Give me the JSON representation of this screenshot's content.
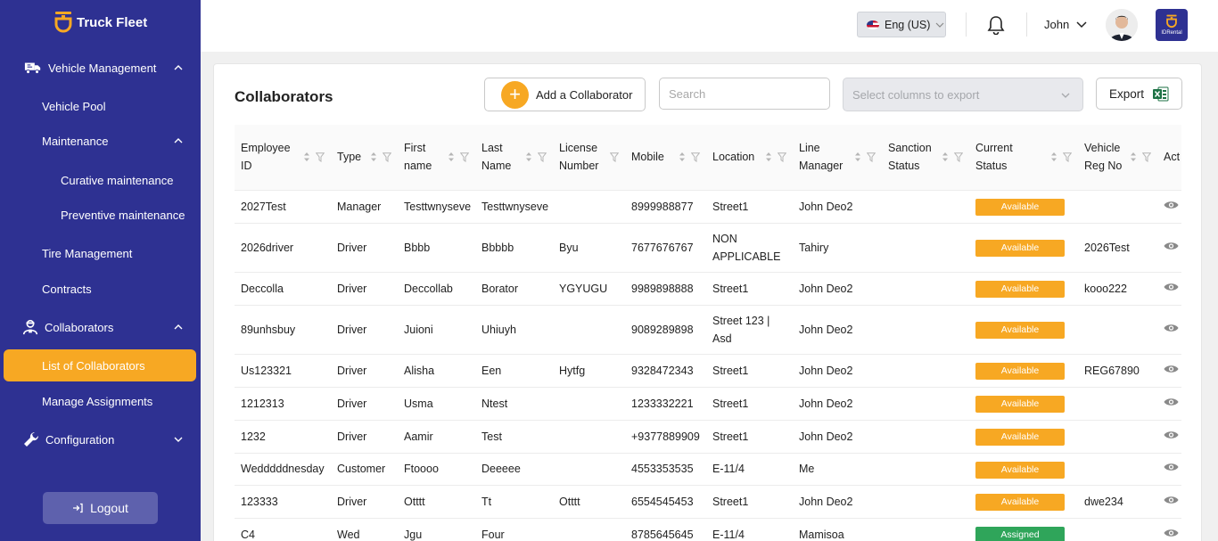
{
  "sidebar": {
    "brand": "Truck Fleet",
    "items": {
      "vehicle_management": "Vehicle Management",
      "vehicle_pool": "Vehicle Pool",
      "maintenance": "Maintenance",
      "curative": "Curative maintenance",
      "preventive": "Preventive maintenance",
      "tire_management": "Tire Management",
      "contracts": "Contracts",
      "collaborators": "Collaborators",
      "list_of_collaborators": "List of Collaborators",
      "manage_assignments": "Manage Assignments",
      "configuration": "Configuration"
    },
    "logout": "Logout",
    "colors": {
      "bg": "#2e3192",
      "active": "#f7a823"
    }
  },
  "header": {
    "language": "Eng (US)",
    "user": "John",
    "app_badge": "IDRental"
  },
  "page": {
    "title": "Collaborators",
    "add_button": "Add a Collaborator",
    "search_placeholder": "Search",
    "export_select_placeholder": "Select columns to export",
    "export_button": "Export"
  },
  "table": {
    "columns": [
      {
        "label": "Employee ID"
      },
      {
        "label": "Type"
      },
      {
        "label": "First name"
      },
      {
        "label": "Last Name"
      },
      {
        "label": "License Number"
      },
      {
        "label": "Mobile"
      },
      {
        "label": "Location"
      },
      {
        "label": "Line Manager"
      },
      {
        "label": "Sanction Status"
      },
      {
        "label": "Current Status"
      },
      {
        "label": "Vehicle Reg No"
      },
      {
        "label": "Act"
      }
    ],
    "rows": [
      {
        "id": "2027Test",
        "type": "Manager",
        "first": "Testtwnyseve",
        "last": "Testtwnyseve",
        "license": "",
        "mobile": "8999988877",
        "location": "Street1",
        "manager": "John Deo2",
        "sanction": "",
        "status": "Available",
        "reg": ""
      },
      {
        "id": "2026driver",
        "type": "Driver",
        "first": "Bbbb",
        "last": "Bbbbb",
        "license": "Byu",
        "mobile": "7677676767",
        "location": "NON APPLICABLE",
        "manager": "Tahiry",
        "sanction": "",
        "status": "Available",
        "reg": "2026Test"
      },
      {
        "id": "Deccolla",
        "type": "Driver",
        "first": "Deccollab",
        "last": "Borator",
        "license": "YGYUGU",
        "mobile": "9989898888",
        "location": "Street1",
        "manager": "John Deo2",
        "sanction": "",
        "status": "Available",
        "reg": "kooo222"
      },
      {
        "id": "89unhsbuy",
        "type": "Driver",
        "first": "Juioni",
        "last": "Uhiuyh",
        "license": "",
        "mobile": "9089289898",
        "location": "Street 123 | Asd",
        "manager": "John Deo2",
        "sanction": "",
        "status": "Available",
        "reg": ""
      },
      {
        "id": "Us123321",
        "type": "Driver",
        "first": "Alisha",
        "last": "Een",
        "license": "Hytfg",
        "mobile": "9328472343",
        "location": "Street1",
        "manager": "John Deo2",
        "sanction": "",
        "status": "Available",
        "reg": "REG67890"
      },
      {
        "id": "1212313",
        "type": "Driver",
        "first": "Usma",
        "last": "Ntest",
        "license": "",
        "mobile": "1233332221",
        "location": "Street1",
        "manager": "John Deo2",
        "sanction": "",
        "status": "Available",
        "reg": ""
      },
      {
        "id": "1232",
        "type": "Driver",
        "first": "Aamir",
        "last": "Test",
        "license": "",
        "mobile": "+9377889909",
        "location": "Street1",
        "manager": "John Deo2",
        "sanction": "",
        "status": "Available",
        "reg": ""
      },
      {
        "id": "Wedddddnesday",
        "type": "Customer",
        "first": "Ftoooo",
        "last": "Deeeee",
        "license": "",
        "mobile": "4553353535",
        "location": "E-11/4",
        "manager": "Me",
        "sanction": "",
        "status": "Available",
        "reg": ""
      },
      {
        "id": "123333",
        "type": "Driver",
        "first": "Otttt",
        "last": "Tt",
        "license": "Otttt",
        "mobile": "6554545453",
        "location": "Street1",
        "manager": "John Deo2",
        "sanction": "",
        "status": "Available",
        "reg": "dwe234"
      },
      {
        "id": "C4",
        "type": "Wed",
        "first": "Jgu",
        "last": "Four",
        "license": "",
        "mobile": "8785645645",
        "location": "E-11/4",
        "manager": "Mamisoa",
        "sanction": "",
        "status": "Assigned",
        "reg": ""
      }
    ],
    "status_colors": {
      "Available": "#f7a823",
      "Assigned": "#2fa55a"
    }
  }
}
